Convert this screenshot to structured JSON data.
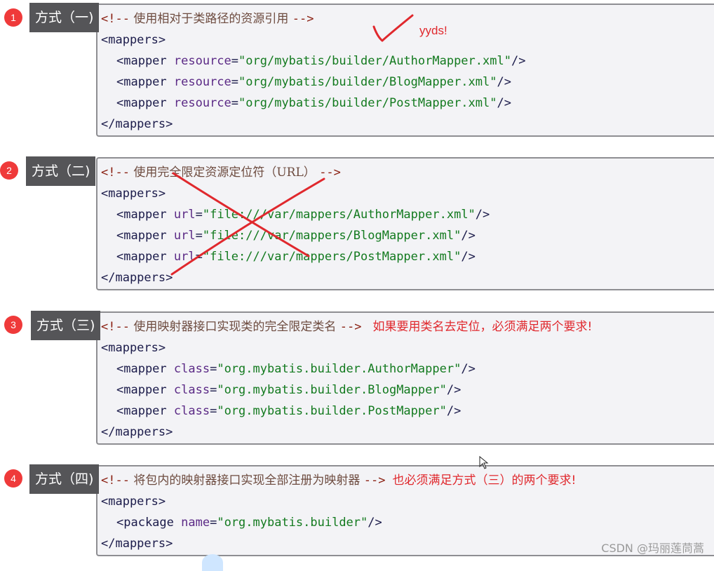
{
  "sections": [
    {
      "badge": "1",
      "label": "方式（一)",
      "comment_open": "<!--",
      "comment_text": " 使用相对于类路径的资源引用 ",
      "comment_close": "-->",
      "note": "",
      "open_tag": "<mappers>",
      "lines": [
        {
          "pre": "<mapper ",
          "attr": "resource",
          "eq": "=",
          "val": "\"org/mybatis/builder/AuthorMapper.xml\"",
          "post": "/>"
        },
        {
          "pre": "<mapper ",
          "attr": "resource",
          "eq": "=",
          "val": "\"org/mybatis/builder/BlogMapper.xml\"",
          "post": "/>"
        },
        {
          "pre": "<mapper ",
          "attr": "resource",
          "eq": "=",
          "val": "\"org/mybatis/builder/PostMapper.xml\"",
          "post": "/>"
        }
      ],
      "close_tag": "</mappers>"
    },
    {
      "badge": "2",
      "label": "方式（二)",
      "comment_open": "<!--",
      "comment_text": " 使用完全限定资源定位符（URL） ",
      "comment_close": "-->",
      "note": "",
      "open_tag": "<mappers>",
      "lines": [
        {
          "pre": "<mapper ",
          "attr": "url",
          "eq": "=",
          "val": "\"file:///var/mappers/AuthorMapper.xml\"",
          "post": "/>"
        },
        {
          "pre": "<mapper ",
          "attr": "url",
          "eq": "=",
          "val": "\"file:///var/mappers/BlogMapper.xml\"",
          "post": "/>"
        },
        {
          "pre": "<mapper ",
          "attr": "url",
          "eq": "=",
          "val": "\"file:///var/mappers/PostMapper.xml\"",
          "post": "/>"
        }
      ],
      "close_tag": "</mappers>"
    },
    {
      "badge": "3",
      "label": "方式（三)",
      "comment_open": "<!--",
      "comment_text": " 使用映射器接口实现类的完全限定类名 ",
      "comment_close": "-->",
      "note": "如果要用类名去定位，必须满足两个要求!",
      "open_tag": "<mappers>",
      "lines": [
        {
          "pre": "<mapper ",
          "attr": "class",
          "eq": "=",
          "val": "\"org.mybatis.builder.AuthorMapper\"",
          "post": "/>"
        },
        {
          "pre": "<mapper ",
          "attr": "class",
          "eq": "=",
          "val": "\"org.mybatis.builder.BlogMapper\"",
          "post": "/>"
        },
        {
          "pre": "<mapper ",
          "attr": "class",
          "eq": "=",
          "val": "\"org.mybatis.builder.PostMapper\"",
          "post": "/>"
        }
      ],
      "close_tag": "</mappers>"
    },
    {
      "badge": "4",
      "label": "方式（四)",
      "comment_open": "<!--",
      "comment_text": " 将包内的映射器接口实现全部注册为映射器 ",
      "comment_close": "-->",
      "note": "也必须满足方式（三）的两个要求!",
      "open_tag": "<mappers>",
      "lines": [
        {
          "pre": "<package ",
          "attr": "name",
          "eq": "=",
          "val": "\"org.mybatis.builder\"",
          "post": "/>"
        }
      ],
      "close_tag": "</mappers>"
    }
  ],
  "annotations": {
    "yyds": "yyds!",
    "watermark": "CSDN @玛丽莲茼蒿"
  },
  "colors": {
    "badge": "#ef3a3a",
    "label_bg": "#555558",
    "code_bg": "#f3f3f6",
    "annotation_red": "#e0282d"
  },
  "icons": [
    "checkmark-icon",
    "cross-mark-icon",
    "mouse-cursor-icon"
  ]
}
